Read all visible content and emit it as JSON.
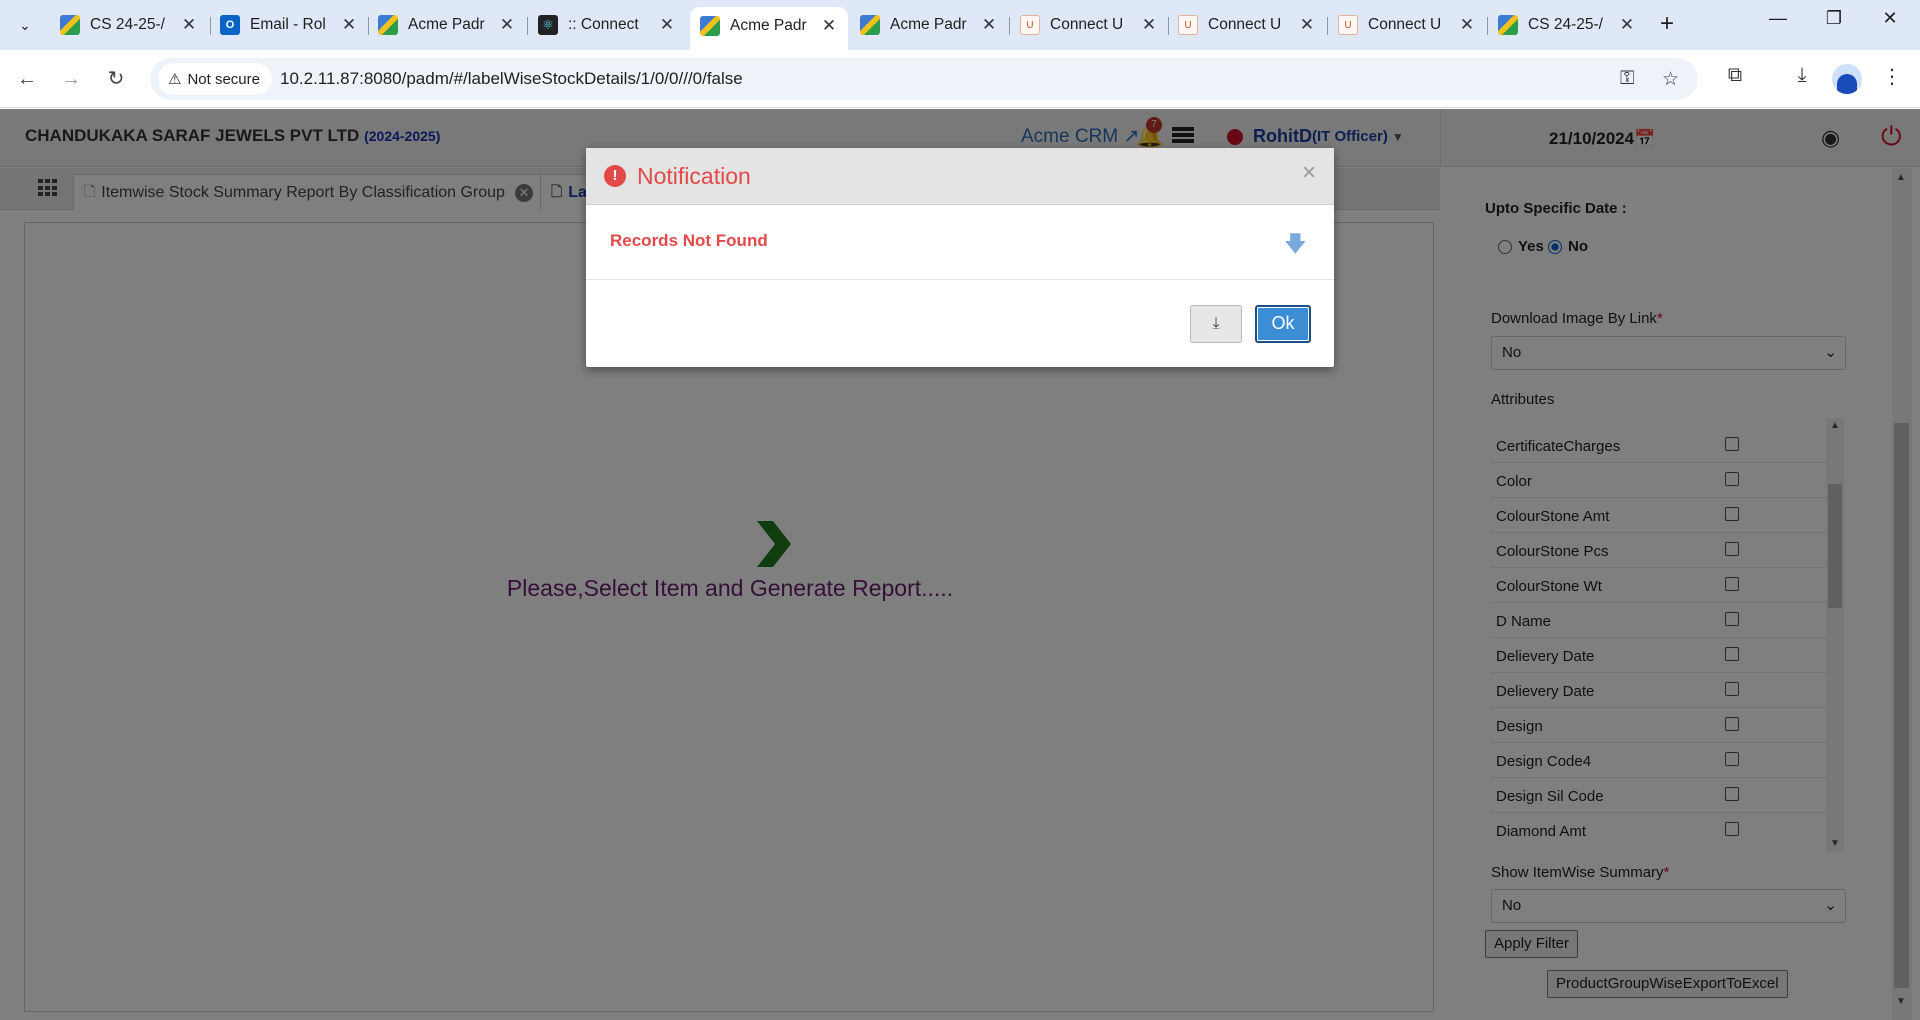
{
  "browser": {
    "tabs": [
      {
        "title": "CS 24-25-/",
        "favicon": "padm"
      },
      {
        "title": "Email - Rol",
        "favicon": "outlook"
      },
      {
        "title": "Acme Padr",
        "favicon": "padm"
      },
      {
        "title": ":: Connect",
        "favicon": "react"
      },
      {
        "title": "Acme Padr",
        "favicon": "padm"
      },
      {
        "title": "Acme Padr",
        "favicon": "padm"
      },
      {
        "title": "Connect U",
        "favicon": "connect"
      },
      {
        "title": "Connect U",
        "favicon": "connect"
      },
      {
        "title": "Connect U",
        "favicon": "connect"
      },
      {
        "title": "CS 24-25-/",
        "favicon": "padm"
      }
    ],
    "security_label": "Not secure",
    "url": "10.2.11.87:8080/padm/#/labelWiseStockDetails/1/0/0///0/false"
  },
  "header": {
    "company": "CHANDUKAKA SARAF JEWELS PVT LTD",
    "fiscal_year": "(2024-2025)",
    "crm_link": "Acme CRM",
    "notification_count": "7",
    "user_name": "RohitD",
    "user_role": "(IT Officer)",
    "date": "21/10/2024"
  },
  "report_tabs": [
    {
      "label": "Itemwise Stock Summary Report By Classification Group"
    },
    {
      "label": "La"
    }
  ],
  "main": {
    "hint": "Please,Select Item and Generate Report....."
  },
  "filters": {
    "upto_date_label": "Upto Specific Date :",
    "yes_label": "Yes",
    "no_label": "No",
    "upto_date_selected": "No",
    "download_image_label": "Download Image By Link",
    "download_image_value": "No",
    "attributes_label": "Attributes",
    "attributes": [
      "CertificateCharges",
      "Color",
      "ColourStone Amt",
      "ColourStone Pcs",
      "ColourStone Wt",
      "D Name",
      "Delievery Date",
      "Delievery Date",
      "Design",
      "Design Code4",
      "Design Sil Code",
      "Diamond Amt"
    ],
    "show_summary_label": "Show ItemWise Summary",
    "show_summary_value": "No",
    "apply_button": "Apply Filter",
    "export_button": "ProductGroupWiseExportToExcel"
  },
  "modal": {
    "title": "Notification",
    "message": "Records Not Found",
    "ok_button": "Ok"
  },
  "colors": {
    "accent": "#3b8ed3",
    "error": "#e24a4a",
    "hint_text": "#6a1e70",
    "success_arrow": "#1f7a1f"
  }
}
